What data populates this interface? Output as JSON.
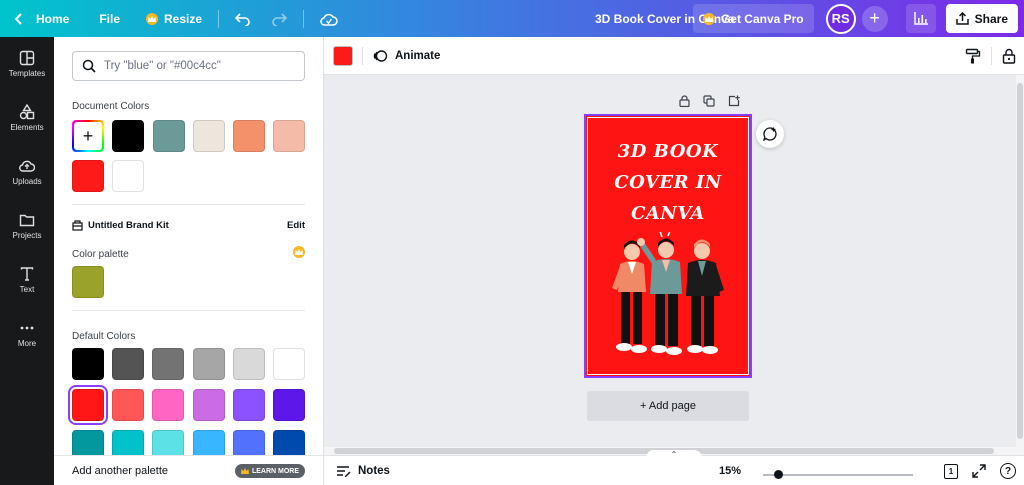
{
  "topbar": {
    "home_label": "Home",
    "file_label": "File",
    "resize_label": "Resize",
    "doc_title": "3D Book Cover in Canva",
    "pro_label": "Get Canva Pro",
    "avatar_initials": "RS",
    "share_label": "Share"
  },
  "rail": {
    "items": [
      {
        "label": "Templates",
        "icon": "templates-icon"
      },
      {
        "label": "Elements",
        "icon": "elements-icon"
      },
      {
        "label": "Uploads",
        "icon": "uploads-icon"
      },
      {
        "label": "Projects",
        "icon": "projects-icon"
      },
      {
        "label": "Text",
        "icon": "text-icon"
      },
      {
        "label": "More",
        "icon": "more-icon"
      }
    ]
  },
  "panel": {
    "search_placeholder": "Try \"blue\" or \"#00c4cc\"",
    "document_colors_label": "Document Colors",
    "document_colors": [
      "#000000",
      "#6b9a98",
      "#ece6dc",
      "#f4906a",
      "#f4bca8",
      "#ff1a1a",
      "#ffffff"
    ],
    "brand_kit_label": "Untitled Brand Kit",
    "edit_label": "Edit",
    "color_palette_label": "Color palette",
    "palette_colors": [
      "#9ba22a"
    ],
    "default_colors_label": "Default Colors",
    "default_colors": [
      "#000000",
      "#545454",
      "#737373",
      "#a6a6a6",
      "#d9d9d9",
      "#ffffff",
      "#ff1616",
      "#ff5757",
      "#ff66c4",
      "#cb6ce6",
      "#8c52ff",
      "#5e17eb",
      "#03989e",
      "#00c2cb",
      "#5ce1e6",
      "#38b6ff",
      "#5271ff",
      "#004aad"
    ],
    "add_palette_label": "Add another palette",
    "learn_more_label": "LEARN MORE"
  },
  "context_toolbar": {
    "selected_color": "#ff1a1a",
    "animate_label": "Animate"
  },
  "canvas": {
    "cover_lines": [
      "3D BOOK",
      "COVER IN",
      "CANVA"
    ],
    "page_background": "#ff1414",
    "add_page_label": "+ Add page"
  },
  "bottombar": {
    "notes_label": "Notes",
    "zoom_value": "15%",
    "page_count": "1",
    "help_label": "?"
  }
}
